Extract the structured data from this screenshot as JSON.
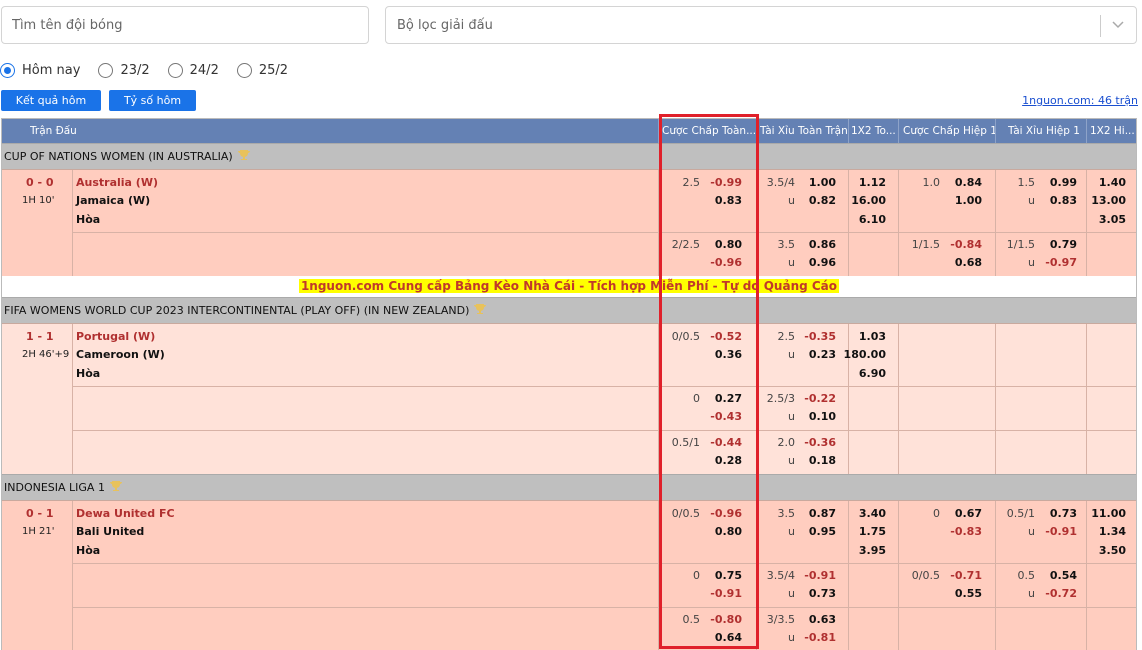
{
  "search": {
    "placeholder": "Tìm tên đội bóng"
  },
  "league_filter": {
    "placeholder": "Bộ lọc giải đấu"
  },
  "dates": [
    {
      "label": "Hôm nay",
      "selected": true
    },
    {
      "label": "23/2",
      "selected": false
    },
    {
      "label": "24/2",
      "selected": false
    },
    {
      "label": "25/2",
      "selected": false
    }
  ],
  "buttons": {
    "results": "Kết quả hôm nay",
    "scores": "Tỷ số hôm nay"
  },
  "match_count": "1nguon.com: 46 trận",
  "columns": [
    "Trận Đấu",
    "Cược Chấp Toàn...",
    "Tài Xỉu Toàn Trận",
    "1X2 To...",
    "Cược Chấp Hiệp 1",
    "Tài Xỉu Hiệp 1",
    "1X2 Hi..."
  ],
  "banner": "1nguon.com Cung cấp Bảng Kèo Nhà Cái - Tích hợp Miễn Phí - Tự do Quảng Cáo",
  "colors": {
    "header": "#6481b4",
    "league": "#bfbfbf",
    "button": "#1a73e8",
    "highlight": "#e0202a",
    "negative": "#b03030"
  },
  "leagues": [
    {
      "name": "CUP OF NATIONS WOMEN (IN AUSTRALIA)",
      "match": {
        "score": "0 - 0",
        "time": "1H 10'",
        "home": "Australia (W)",
        "away": "Jamaica (W)",
        "draw": "Hòa",
        "rows": [
          {
            "hcp": "2.5",
            "hcp_h": "-0.99",
            "hcp_a": "0.83",
            "ou": "3.5/4",
            "ou_o": "1.00",
            "u": "u",
            "ou_u": "0.82",
            "x1": "1.12",
            "x2": "16.00",
            "xd": "6.10",
            "h1": "1.0",
            "h1_h": "0.84",
            "h1_a": "1.00",
            "hou": "1.5",
            "hou_o": "0.99",
            "hu": "u",
            "hou_u": "0.83",
            "hx1": "1.40",
            "hx2": "13.00",
            "hxd": "3.05"
          },
          {
            "hcp": "2/2.5",
            "hcp_h": "0.80",
            "hcp_a": "-0.96",
            "ou": "3.5",
            "ou_o": "0.86",
            "u": "u",
            "ou_u": "0.96",
            "x1": "",
            "x2": "",
            "xd": "",
            "h1": "1/1.5",
            "h1_h": "-0.84",
            "h1_a": "0.68",
            "hou": "1/1.5",
            "hou_o": "0.79",
            "hu": "u",
            "hou_u": "-0.97",
            "hx1": "",
            "hx2": "",
            "hxd": ""
          }
        ]
      }
    },
    {
      "name": "FIFA WOMENS WORLD CUP 2023 INTERCONTINENTAL (PLAY OFF) (IN NEW ZEALAND)",
      "match": {
        "score": "1 - 1",
        "time": "2H 46'+9",
        "home": "Portugal (W)",
        "away": "Cameroon (W)",
        "draw": "Hòa",
        "rows": [
          {
            "hcp": "0/0.5",
            "hcp_h": "-0.52",
            "hcp_a": "0.36",
            "ou": "2.5",
            "ou_o": "-0.35",
            "u": "u",
            "ou_u": "0.23",
            "x1": "1.03",
            "x2": "180.00",
            "xd": "6.90",
            "h1": "",
            "h1_h": "",
            "h1_a": "",
            "hou": "",
            "hou_o": "",
            "hu": "",
            "hou_u": "",
            "hx1": "",
            "hx2": "",
            "hxd": ""
          },
          {
            "hcp": "0",
            "hcp_h": "0.27",
            "hcp_a": "-0.43",
            "ou": "2.5/3",
            "ou_o": "-0.22",
            "u": "u",
            "ou_u": "0.10",
            "x1": "",
            "x2": "",
            "xd": "",
            "h1": "",
            "h1_h": "",
            "h1_a": "",
            "hou": "",
            "hou_o": "",
            "hu": "",
            "hou_u": "",
            "hx1": "",
            "hx2": "",
            "hxd": ""
          },
          {
            "hcp": "0.5/1",
            "hcp_h": "-0.44",
            "hcp_a": "0.28",
            "ou": "2.0",
            "ou_o": "-0.36",
            "u": "u",
            "ou_u": "0.18",
            "x1": "",
            "x2": "",
            "xd": "",
            "h1": "",
            "h1_h": "",
            "h1_a": "",
            "hou": "",
            "hou_o": "",
            "hu": "",
            "hou_u": "",
            "hx1": "",
            "hx2": "",
            "hxd": ""
          }
        ]
      }
    },
    {
      "name": "INDONESIA LIGA 1",
      "match": {
        "score": "0 - 1",
        "time": "1H 21'",
        "home": "Dewa United FC",
        "away": "Bali United",
        "draw": "Hòa",
        "rows": [
          {
            "hcp": "0/0.5",
            "hcp_h": "-0.96",
            "hcp_a": "0.80",
            "ou": "3.5",
            "ou_o": "0.87",
            "u": "u",
            "ou_u": "0.95",
            "x1": "3.40",
            "x2": "1.75",
            "xd": "3.95",
            "h1": "0",
            "h1_h": "0.67",
            "h1_a": "-0.83",
            "hou": "0.5/1",
            "hou_o": "0.73",
            "hu": "u",
            "hou_u": "-0.91",
            "hx1": "11.00",
            "hx2": "1.34",
            "hxd": "3.50"
          },
          {
            "hcp": "0",
            "hcp_h": "0.75",
            "hcp_a": "-0.91",
            "ou": "3.5/4",
            "ou_o": "-0.91",
            "u": "u",
            "ou_u": "0.73",
            "x1": "",
            "x2": "",
            "xd": "",
            "h1": "0/0.5",
            "h1_h": "-0.71",
            "h1_a": "0.55",
            "hou": "0.5",
            "hou_o": "0.54",
            "hu": "u",
            "hou_u": "-0.72",
            "hx1": "",
            "hx2": "",
            "hxd": ""
          },
          {
            "hcp": "0.5",
            "hcp_h": "-0.80",
            "hcp_a": "0.64",
            "ou": "3/3.5",
            "ou_o": "0.63",
            "u": "u",
            "ou_u": "-0.81",
            "x1": "",
            "x2": "",
            "xd": "",
            "h1": "",
            "h1_h": "",
            "h1_a": "",
            "hou": "",
            "hou_o": "",
            "hu": "",
            "hou_u": "",
            "hx1": "",
            "hx2": "",
            "hxd": ""
          }
        ]
      }
    }
  ]
}
